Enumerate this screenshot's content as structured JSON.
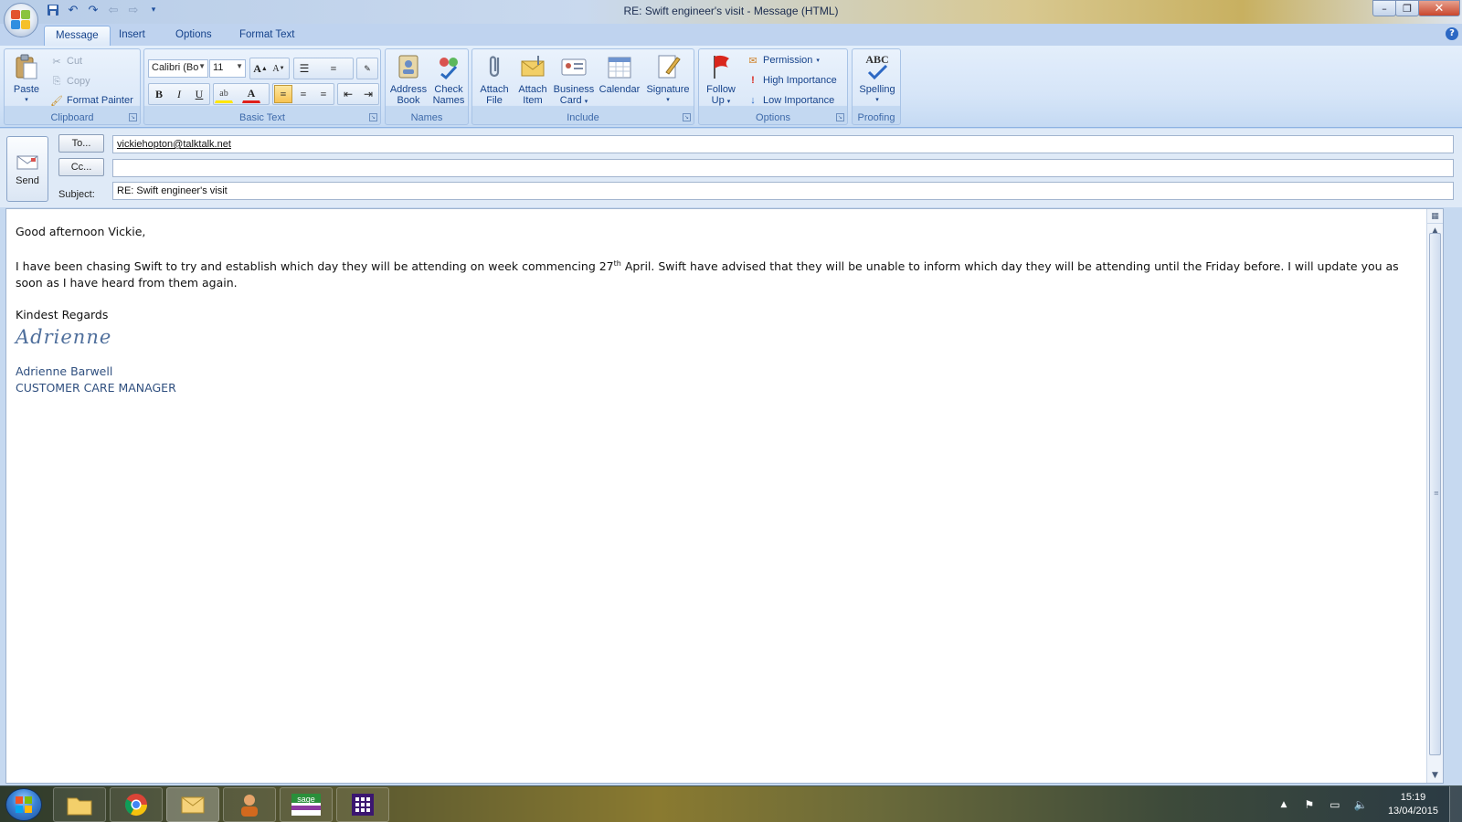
{
  "window": {
    "title": "RE: Swift engineer's visit - Message (HTML)",
    "minimize": "–",
    "restore": "❐",
    "close": "✕"
  },
  "tabs": [
    {
      "label": "Message",
      "active": true
    },
    {
      "label": "Insert"
    },
    {
      "label": "Options"
    },
    {
      "label": "Format Text"
    }
  ],
  "ribbon": {
    "clipboard": {
      "label": "Clipboard",
      "paste": "Paste",
      "cut": "Cut",
      "copy": "Copy",
      "format_painter": "Format Painter"
    },
    "basic_text": {
      "label": "Basic Text",
      "font_name": "Calibri (Bo",
      "font_size": "11",
      "bold": "B",
      "italic": "I",
      "underline": "U"
    },
    "names": {
      "label": "Names",
      "address_book_1": "Address",
      "address_book_2": "Book",
      "check_names_1": "Check",
      "check_names_2": "Names"
    },
    "include": {
      "label": "Include",
      "attach_file_1": "Attach",
      "attach_file_2": "File",
      "attach_item_1": "Attach",
      "attach_item_2": "Item",
      "business_card_1": "Business",
      "business_card_2": "Card",
      "calendar": "Calendar",
      "signature": "Signature"
    },
    "options": {
      "label": "Options",
      "follow_up_1": "Follow",
      "follow_up_2": "Up",
      "permission": "Permission",
      "high_importance": "High Importance",
      "low_importance": "Low Importance"
    },
    "proofing": {
      "label": "Proofing",
      "spelling": "Spelling",
      "abc": "ABC"
    }
  },
  "header": {
    "send": "Send",
    "to_button": "To...",
    "cc_button": "Cc...",
    "subject_label": "Subject:",
    "to_value": "vickiehopton@talktalk.net",
    "cc_value": "",
    "subject_value": "RE: Swift engineer's visit"
  },
  "body": {
    "greeting": "Good afternoon Vickie,",
    "para_part1": "I have been chasing Swift to try and establish which day they will be attending on week commencing 27",
    "para_sup": "th",
    "para_part2": " April.  Swift have advised that they will be unable to inform which day they will be attending until the Friday before.    I will update you as soon as I have heard from them again.",
    "closing": "Kindest Regards",
    "signature_script": "Adrienne",
    "sig_name": "Adrienne Barwell",
    "sig_title": "CUSTOMER CARE MANAGER"
  },
  "taskbar": {
    "time": "15:19",
    "date": "13/04/2015",
    "apps": [
      "explorer",
      "chrome",
      "outlook",
      "user-app",
      "sage",
      "calculator-app"
    ]
  },
  "colors": {
    "ribbon_text": "#15428b",
    "accent": "#2c68c4"
  }
}
